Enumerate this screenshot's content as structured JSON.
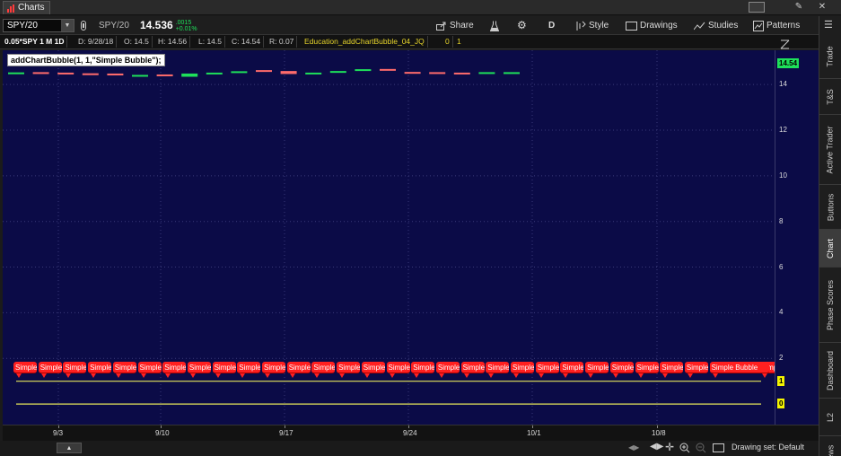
{
  "app": {
    "tab_label": "Charts"
  },
  "toolbar": {
    "symbol_value": "SPY/20",
    "symbol_description": "SPY/20",
    "last_price": "14.536",
    "net_change": ".0015",
    "net_change_pct": "+0.01%",
    "share_label": "Share",
    "aggregation_label": "D",
    "style_label": "Style",
    "drawings_label": "Drawings",
    "studies_label": "Studies",
    "patterns_label": "Patterns"
  },
  "info_row": {
    "symbol": "0.05*SPY 1 M 1D",
    "date": "D: 9/28/18",
    "open": "O: 14.5",
    "high": "H: 14.56",
    "low": "L: 14.5",
    "close": "C: 14.54",
    "range": "R: 0.07",
    "study_name": "Education_addChartBubble_04_JQ",
    "study_val_1": "0",
    "study_val_2": "1"
  },
  "chart": {
    "code_label": "addChartBubble(1, 1,\"Simple Bubble\");",
    "bubble_text": "Simple Bubble",
    "last_price_tag": "14.54",
    "plot_tag_1": "1",
    "plot_tag_0": "0",
    "colors": {
      "background": "#0b0b47",
      "up": "#1ee05a",
      "down": "#ff6b6b",
      "bubble": "#ff2020",
      "plot_line": "#e6e65a",
      "price_tag": "#1ee05a"
    }
  },
  "chart_data": {
    "type": "candlestick",
    "ylim": [
      -0.9,
      15.5
    ],
    "yticks": [
      "14",
      "12",
      "10",
      "8",
      "6",
      "4",
      "2"
    ],
    "x_dates": [
      "9/3",
      "9/10",
      "9/17",
      "9/24",
      "10/1",
      "10/8"
    ],
    "candles": [
      {
        "o": 14.5,
        "c": 14.53
      },
      {
        "o": 14.54,
        "c": 14.5
      },
      {
        "o": 14.52,
        "c": 14.49
      },
      {
        "o": 14.49,
        "c": 14.47
      },
      {
        "o": 14.48,
        "c": 14.4
      },
      {
        "o": 14.36,
        "c": 14.42
      },
      {
        "o": 14.44,
        "c": 14.4
      },
      {
        "o": 14.34,
        "c": 14.48
      },
      {
        "o": 14.47,
        "c": 14.52
      },
      {
        "o": 14.56,
        "c": 14.58
      },
      {
        "o": 14.63,
        "c": 14.61
      },
      {
        "o": 14.59,
        "c": 14.46
      },
      {
        "o": 14.48,
        "c": 14.52
      },
      {
        "o": 14.57,
        "c": 14.59
      },
      {
        "o": 14.62,
        "c": 14.67
      },
      {
        "o": 14.68,
        "c": 14.63
      },
      {
        "o": 14.55,
        "c": 14.54
      },
      {
        "o": 14.54,
        "c": 14.52
      },
      {
        "o": 14.52,
        "c": 14.47
      },
      {
        "o": 14.52,
        "c": 14.54
      },
      {
        "o": 14.5,
        "c": 14.54
      }
    ],
    "plot_lines": [
      {
        "name": "1",
        "value": 1
      },
      {
        "name": "0",
        "value": 0
      }
    ]
  },
  "footer": {
    "drawing_set": "Drawing set: Default"
  },
  "sidebar": {
    "tabs": [
      "Trade",
      "T&S",
      "Active Trader",
      "Buttons",
      "Chart",
      "Phase Scores",
      "Dashboard",
      "L2",
      "News"
    ]
  }
}
